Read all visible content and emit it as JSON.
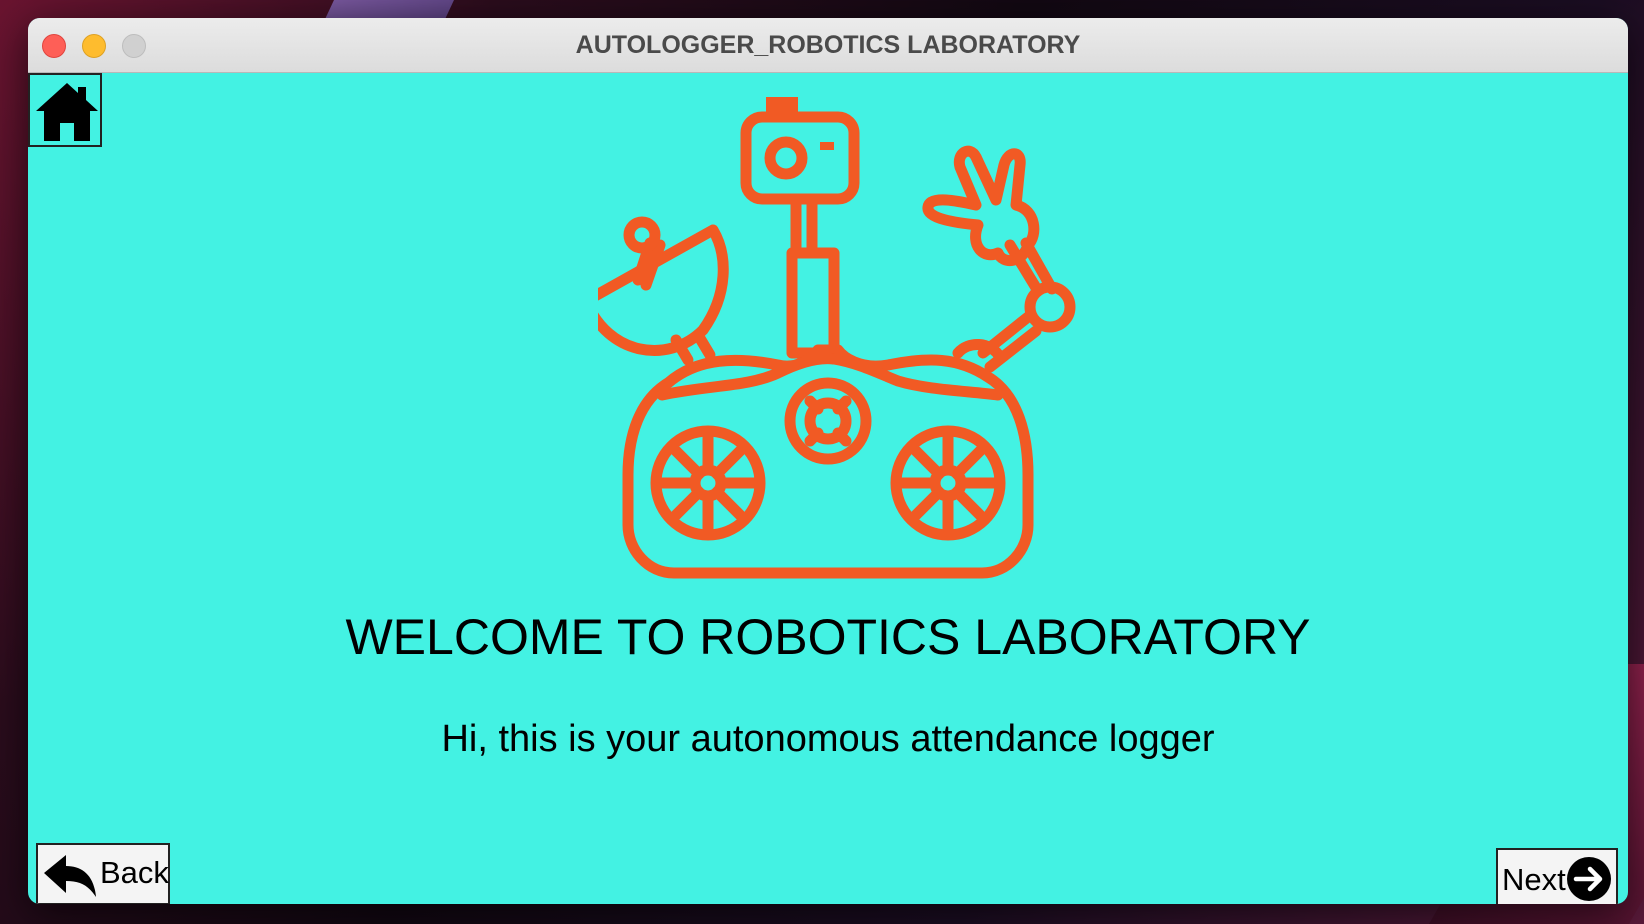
{
  "window": {
    "title": "AUTOLOGGER_ROBOTICS LABORATORY"
  },
  "toolbar": {
    "home_icon": "home-icon"
  },
  "main": {
    "illustration": "rover-robot-icon",
    "accent_color": "#f15a24",
    "background_color": "#43f2e3",
    "heading": "WELCOME TO ROBOTICS LABORATORY",
    "subtitle": "Hi, this is your autonomous attendance logger"
  },
  "nav": {
    "back_label": "Back",
    "back_icon": "back-arrow-icon",
    "next_label": "Next",
    "next_icon": "arrow-right-circle-icon"
  }
}
